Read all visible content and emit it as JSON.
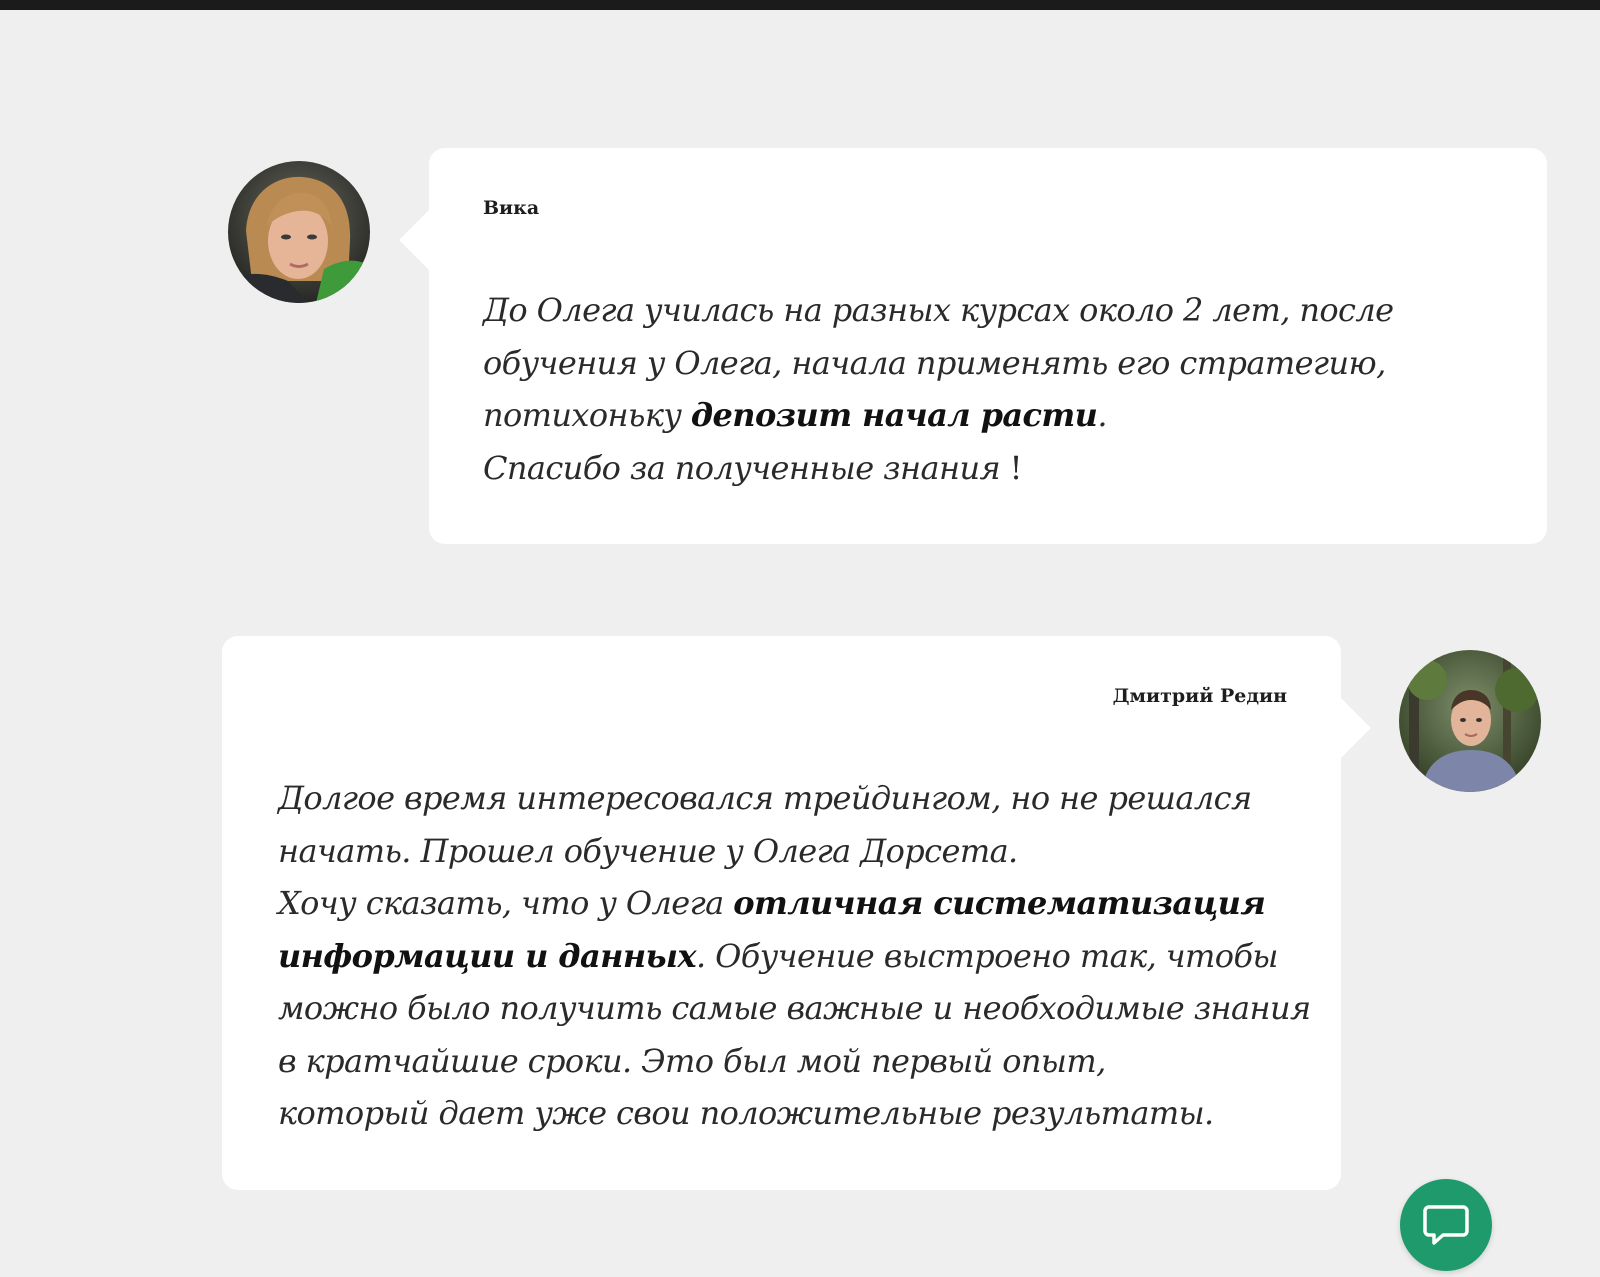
{
  "colors": {
    "background": "#efefef",
    "card": "#ffffff",
    "chat_accent": "#1f9a6c"
  },
  "reviews": [
    {
      "author": "Вика",
      "avatar_icon": "photo-woman",
      "lines": [
        {
          "parts": [
            "До Олега училась на разных курсах около 2 лет, после"
          ]
        },
        {
          "parts": [
            "обучения у Олега, начала применять его стратегию,"
          ]
        },
        {
          "parts": [
            "потихоньку ",
            "депозит начал расти",
            "."
          ]
        },
        {
          "parts": [
            "Спасибо за полученные знания",
            " !"
          ]
        }
      ]
    },
    {
      "author": "Дмитрий Редин",
      "avatar_icon": "photo-man",
      "lines": [
        {
          "parts": [
            "Долгое время интересовался трейдингом, но не решался"
          ]
        },
        {
          "parts": [
            "начать. Прошел обучение у Олега Дорсета."
          ]
        },
        {
          "parts": [
            "Хочу сказать, что у Олега ",
            "отличная систематизация"
          ]
        },
        {
          "parts": [
            "информации и данных",
            ". Обучение выстроено так, чтобы"
          ]
        },
        {
          "parts": [
            "можно было получить самые важные и необходимые знания"
          ]
        },
        {
          "parts": [
            "в кратчайшие сроки. Это был мой первый опыт,"
          ]
        },
        {
          "parts": [
            "который дает уже свои положительные результаты."
          ]
        }
      ]
    }
  ],
  "chat_widget": {
    "icon": "chat-bubble-icon"
  }
}
